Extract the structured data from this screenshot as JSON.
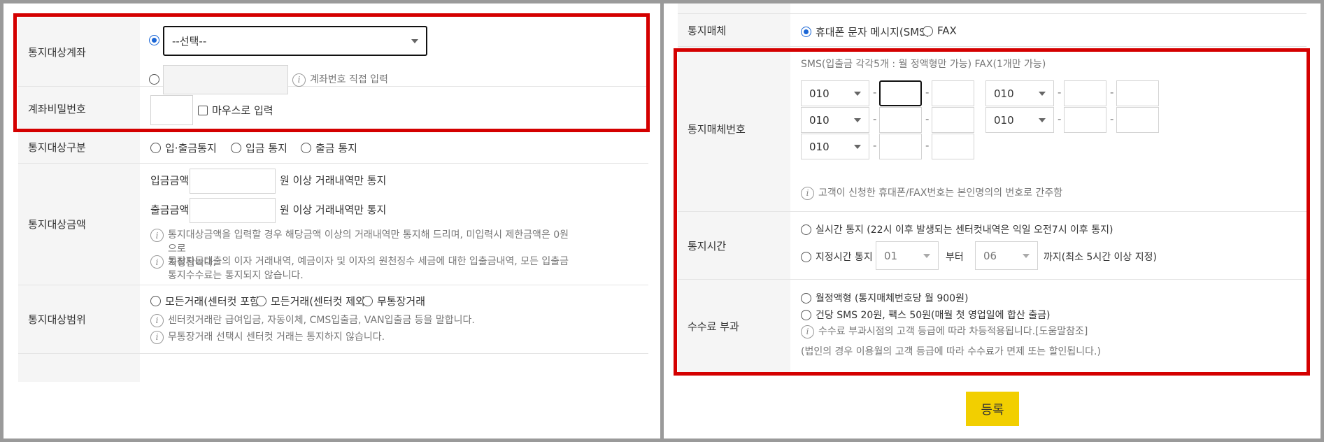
{
  "left": {
    "account": {
      "label": "통지대상계좌",
      "select_value": "--선택--",
      "manual_note": "계좌번호 직접 입력"
    },
    "password": {
      "label": "계좌비밀번호",
      "mouse_input": "마우스로 입력"
    },
    "target_type": {
      "label": "통지대상구분",
      "options": [
        "입·출금통지",
        "입금 통지",
        "출금 통지"
      ]
    },
    "amount": {
      "label": "통지대상금액",
      "deposit_label": "입금금액",
      "withdraw_label": "출금금액",
      "suffix": "원 이상 거래내역만 통지",
      "note1_line1": "통지대상금액을 입력할 경우 해당금액 이상의 거래내역만 통지해 드리며, 미입력시 제한금액은 0원으로",
      "note1_line2": "지정됩니다.",
      "note2_line1": "통장자동대출의 이자 거래내역, 예금이자 및 이자의 원천징수 세금에 대한 입출금내역, 모든 입출금",
      "note2_line2": "통지수수료는 통지되지 않습니다."
    },
    "range": {
      "label": "통지대상범위",
      "options": [
        "모든거래(센터컷 포함)",
        "모든거래(센터컷 제외)",
        "무통장거래"
      ],
      "note1": "센터컷거래란 급여입금, 자동이체, CMS입출금, VAN입출금 등을 말합니다.",
      "note2": "무통장거래 선택시 센터컷 거래는 통지하지 않습니다."
    }
  },
  "right": {
    "medium": {
      "label": "통지매체",
      "options": [
        "휴대폰 문자 메시지(SMS)",
        "FAX"
      ]
    },
    "number": {
      "label": "통지매체번호",
      "header": "SMS(입출금 각각5개 : 월 정액형만 가능) FAX(1개만 가능)",
      "prefix": "010",
      "dash": "-",
      "note": "고객이 신청한 휴대폰/FAX번호는 본인명의의 번호로 간주함"
    },
    "time": {
      "label": "통지시간",
      "realtime": "실시간 통지 (22시 이후 발생되는 센터컷내역은 익일 오전7시 이후 통지)",
      "scheduled": "지정시간 통지",
      "from_value": "01",
      "from_suffix": "부터",
      "to_value": "06",
      "to_suffix": "까지(최소 5시간 이상 지정)"
    },
    "fee": {
      "label": "수수료 부과",
      "opt1": "월정액형 (통지매체번호당 월 900원)",
      "opt2": "건당 SMS 20원, 팩스 50원(매월 첫 영업일에 합산 출금)",
      "note": "수수료 부과시점의 고객 등급에 따라 차등적용됩니다.[도움말참조]",
      "corp_note": "(법인의 경우 이용월의 고객 등급에 따라 수수료가 면제 또는 할인됩니다.)"
    },
    "register_label": "등록"
  },
  "colors": {
    "highlight": "#d40000",
    "button": "#f2cf00",
    "radio_selected": "#1a66d6"
  }
}
